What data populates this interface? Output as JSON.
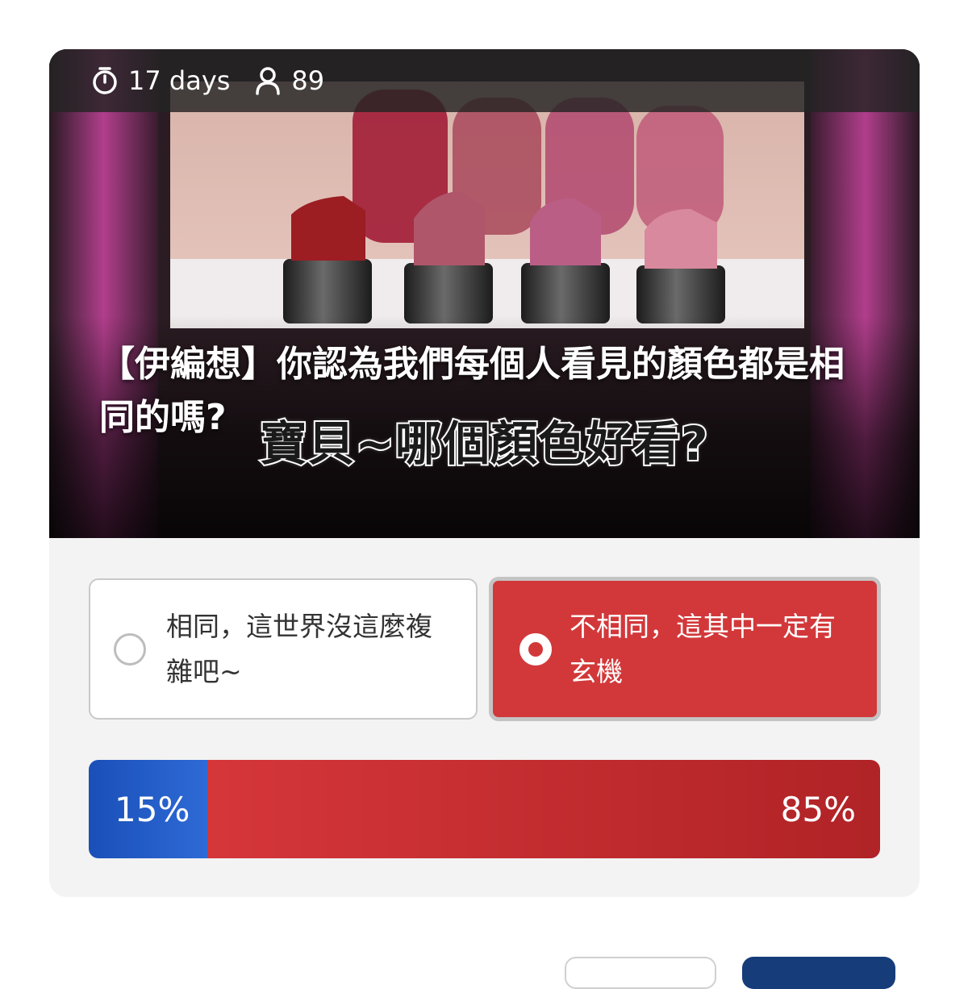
{
  "poll": {
    "remaining": "17 days",
    "participants": "89",
    "question": "【伊編想】你認為我們每個人看見的顏色都是相同的嗎?",
    "image_caption": "寶貝~哪個顏色好看?",
    "options": [
      {
        "label": "相同，這世界沒這麼複雜吧~",
        "selected": false
      },
      {
        "label": "不相同，這其中一定有玄機",
        "selected": true
      }
    ],
    "results": [
      {
        "percent_label": "15%",
        "share": 0.15,
        "color": "#1a4fb8"
      },
      {
        "percent_label": "85%",
        "share": 0.85,
        "color": "#d2383a"
      }
    ]
  },
  "icons": {
    "timer": "stopwatch-icon",
    "participants": "user-icon"
  },
  "colors": {
    "selected_option": "#d2383a",
    "bar_blue": "#1a4fb8",
    "bar_red": "#c62e31"
  }
}
